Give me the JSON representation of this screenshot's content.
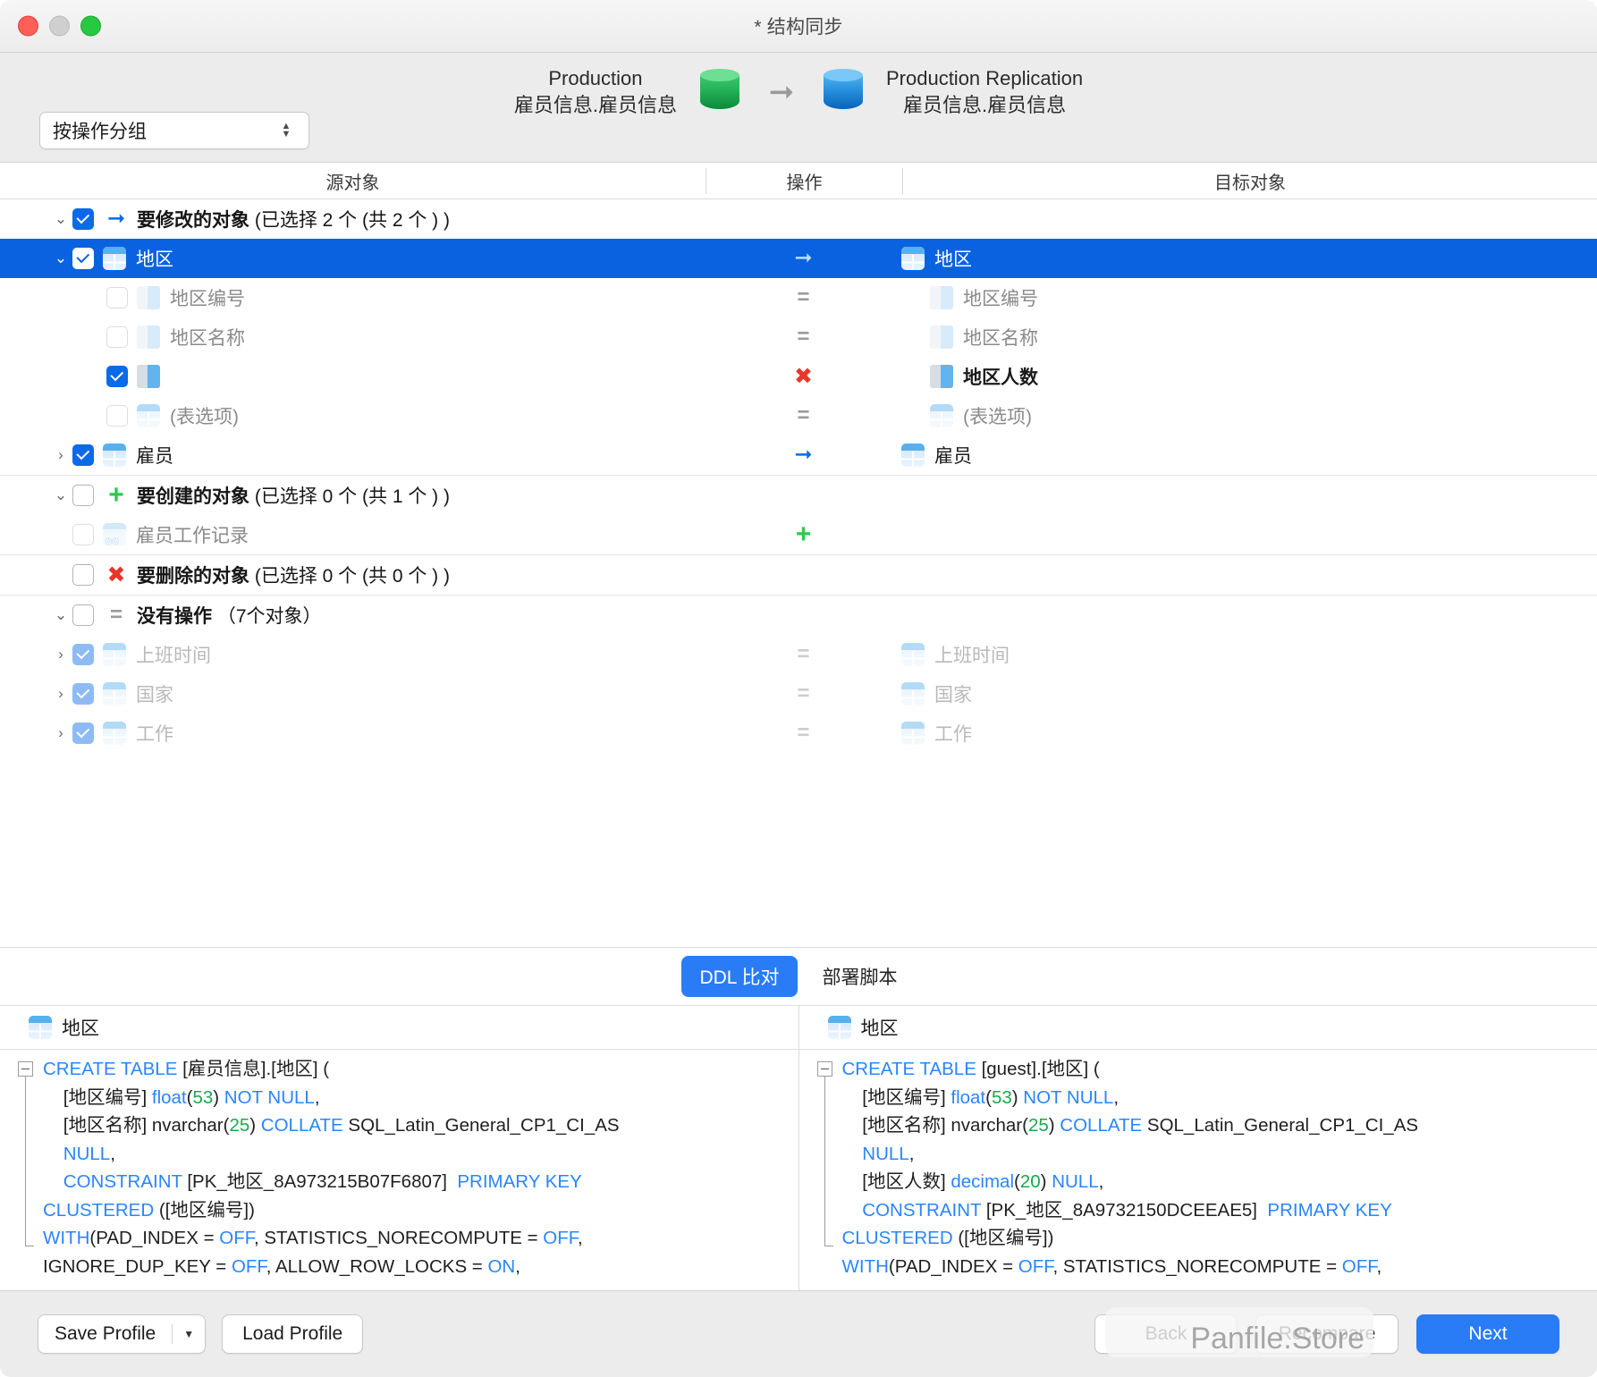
{
  "window": {
    "title": "* 结构同步",
    "traffic_lights": [
      "close-button",
      "minimize-button",
      "zoom-button"
    ]
  },
  "header": {
    "group_select_value": "按操作分组",
    "source": {
      "name": "Production",
      "schema": "雇员信息.雇员信息",
      "icon": "database-green-icon"
    },
    "direction_icon": "arrow-right-icon",
    "target": {
      "name": "Production Replication",
      "schema": "雇员信息.雇员信息",
      "icon": "database-blue-icon"
    }
  },
  "columns": {
    "source": "源对象",
    "action": "操作",
    "target": "目标对象"
  },
  "tree": {
    "groups": [
      {
        "id": "modify",
        "header": {
          "label": "要修改的对象",
          "count_text": "(已选择 2 个 (共 2 个 ) )",
          "icon": "arrow-right-icon",
          "checked": true,
          "expanded": true
        },
        "rows": [
          {
            "source": "地区",
            "action": "arrow-right-icon",
            "target": "地区",
            "icon": "table-icon",
            "checked": true,
            "expanded": true,
            "selected": true,
            "indent": 2,
            "state": "normal"
          },
          {
            "source": "地区编号",
            "action": "equals-icon",
            "target": "地区编号",
            "icon": "column-icon",
            "checked": false,
            "indent": 3,
            "state": "dim"
          },
          {
            "source": "地区名称",
            "action": "equals-icon",
            "target": "地区名称",
            "icon": "column-icon",
            "checked": false,
            "indent": 3,
            "state": "dim"
          },
          {
            "source": "",
            "action": "cross-icon",
            "target": "地区人数",
            "icon": "column-icon",
            "checked": true,
            "indent": 3,
            "state": "bold"
          },
          {
            "source": "(表选项)",
            "action": "equals-icon",
            "target": "(表选项)",
            "icon": "table-options-icon",
            "checked": false,
            "indent": 3,
            "state": "dim"
          },
          {
            "source": "雇员",
            "action": "arrow-right-icon",
            "target": "雇员",
            "icon": "table-icon",
            "checked": true,
            "expanded": false,
            "indent": 2,
            "state": "normal"
          }
        ]
      },
      {
        "id": "create",
        "header": {
          "label": "要创建的对象",
          "count_text": "(已选择 0 个 (共 1 个 ) )",
          "icon": "plus-icon",
          "checked": false,
          "expanded": true
        },
        "rows": [
          {
            "source": "雇员工作记录",
            "action": "plus-icon",
            "target": "",
            "icon": "function-icon",
            "checked": false,
            "indent": 2,
            "state": "dim"
          }
        ]
      },
      {
        "id": "delete",
        "header": {
          "label": "要删除的对象",
          "count_text": "(已选择 0 个 (共 0 个 ) )",
          "icon": "cross-icon",
          "checked": false,
          "expanded": false
        },
        "rows": []
      },
      {
        "id": "noaction",
        "header": {
          "label": "没有操作",
          "count_text": "（7个对象）",
          "icon": "equals-icon",
          "checked": false,
          "expanded": true
        },
        "rows": [
          {
            "source": "上班时间",
            "action": "equals-icon",
            "target": "上班时间",
            "icon": "table-icon",
            "checked": true,
            "expanded": false,
            "indent": 2,
            "state": "faded"
          },
          {
            "source": "国家",
            "action": "equals-icon",
            "target": "国家",
            "icon": "table-icon",
            "checked": true,
            "expanded": false,
            "indent": 2,
            "state": "faded"
          },
          {
            "source": "工作",
            "action": "equals-icon",
            "target": "工作",
            "icon": "table-icon",
            "checked": true,
            "expanded": false,
            "indent": 2,
            "state": "faded"
          }
        ]
      }
    ]
  },
  "tabs": {
    "ddl_compare": "DDL 比对",
    "deploy_script": "部署脚本",
    "active": "DDL 比对"
  },
  "ddl": {
    "left": {
      "title": "地区",
      "lines": [
        [
          {
            "t": "CREATE TABLE ",
            "c": "kw"
          },
          {
            "t": "[雇员信息].[地区] (",
            "c": "pl"
          }
        ],
        [
          {
            "t": "    [地区编号] ",
            "c": "pl"
          },
          {
            "t": "float",
            "c": "kw"
          },
          {
            "t": "(",
            "c": "pl"
          },
          {
            "t": "53",
            "c": "num"
          },
          {
            "t": ") ",
            "c": "pl"
          },
          {
            "t": "NOT NULL",
            "c": "kw"
          },
          {
            "t": ",",
            "c": "pl"
          }
        ],
        [
          {
            "t": "    [地区名称] nvarchar(",
            "c": "pl"
          },
          {
            "t": "25",
            "c": "num"
          },
          {
            "t": ") ",
            "c": "pl"
          },
          {
            "t": "COLLATE ",
            "c": "kw"
          },
          {
            "t": "SQL_Latin_General_CP1_CI_AS",
            "c": "pl"
          }
        ],
        [
          {
            "t": "    NULL",
            "c": "kw"
          },
          {
            "t": ",",
            "c": "pl"
          }
        ],
        [
          {
            "t": "    CONSTRAINT ",
            "c": "kw"
          },
          {
            "t": "[PK_地区_8A973215B07F6807]  ",
            "c": "pl"
          },
          {
            "t": "PRIMARY KEY",
            "c": "kw"
          }
        ],
        [
          {
            "t": "CLUSTERED ",
            "c": "kw"
          },
          {
            "t": "([地区编号])",
            "c": "pl"
          }
        ],
        [
          {
            "t": "WITH",
            "c": "kw"
          },
          {
            "t": "(PAD_INDEX = ",
            "c": "pl"
          },
          {
            "t": "OFF",
            "c": "kw"
          },
          {
            "t": ", STATISTICS_NORECOMPUTE = ",
            "c": "pl"
          },
          {
            "t": "OFF",
            "c": "kw"
          },
          {
            "t": ",",
            "c": "pl"
          }
        ],
        [
          {
            "t": "IGNORE_DUP_KEY = ",
            "c": "pl"
          },
          {
            "t": "OFF",
            "c": "kw"
          },
          {
            "t": ", ALLOW_ROW_LOCKS = ",
            "c": "pl"
          },
          {
            "t": "ON",
            "c": "kw"
          },
          {
            "t": ",",
            "c": "pl"
          }
        ]
      ]
    },
    "right": {
      "title": "地区",
      "lines": [
        [
          {
            "t": "CREATE TABLE ",
            "c": "kw"
          },
          {
            "t": "[guest].[地区] (",
            "c": "pl"
          }
        ],
        [
          {
            "t": "    [地区编号] ",
            "c": "pl"
          },
          {
            "t": "float",
            "c": "kw"
          },
          {
            "t": "(",
            "c": "pl"
          },
          {
            "t": "53",
            "c": "num"
          },
          {
            "t": ") ",
            "c": "pl"
          },
          {
            "t": "NOT NULL",
            "c": "kw"
          },
          {
            "t": ",",
            "c": "pl"
          }
        ],
        [
          {
            "t": "    [地区名称] nvarchar(",
            "c": "pl"
          },
          {
            "t": "25",
            "c": "num"
          },
          {
            "t": ") ",
            "c": "pl"
          },
          {
            "t": "COLLATE ",
            "c": "kw"
          },
          {
            "t": "SQL_Latin_General_CP1_CI_AS",
            "c": "pl"
          }
        ],
        [
          {
            "t": "    NULL",
            "c": "kw"
          },
          {
            "t": ",",
            "c": "pl"
          }
        ],
        [
          {
            "t": "    [地区人数] ",
            "c": "pl"
          },
          {
            "t": "decimal",
            "c": "kw"
          },
          {
            "t": "(",
            "c": "pl"
          },
          {
            "t": "20",
            "c": "num"
          },
          {
            "t": ") ",
            "c": "pl"
          },
          {
            "t": "NULL",
            "c": "kw"
          },
          {
            "t": ",",
            "c": "pl"
          }
        ],
        [
          {
            "t": "    CONSTRAINT ",
            "c": "kw"
          },
          {
            "t": "[PK_地区_8A9732150DCEEAE5]  ",
            "c": "pl"
          },
          {
            "t": "PRIMARY KEY",
            "c": "kw"
          }
        ],
        [
          {
            "t": "CLUSTERED ",
            "c": "kw"
          },
          {
            "t": "([地区编号])",
            "c": "pl"
          }
        ],
        [
          {
            "t": "WITH",
            "c": "kw"
          },
          {
            "t": "(PAD_INDEX = ",
            "c": "pl"
          },
          {
            "t": "OFF",
            "c": "kw"
          },
          {
            "t": ", STATISTICS_NORECOMPUTE = ",
            "c": "pl"
          },
          {
            "t": "OFF",
            "c": "kw"
          },
          {
            "t": ",",
            "c": "pl"
          }
        ]
      ]
    }
  },
  "footer": {
    "save_profile": "Save Profile",
    "load_profile": "Load Profile",
    "back": "Back",
    "recompare": "Recompare",
    "next": "Next"
  },
  "watermark": "Panfile.Store",
  "colors": {
    "accent": "#0a6ae8",
    "selection": "#0a62e0",
    "add": "#30c64f",
    "remove": "#e8362b",
    "keyword": "#2a85ff",
    "number": "#18aa4e"
  }
}
